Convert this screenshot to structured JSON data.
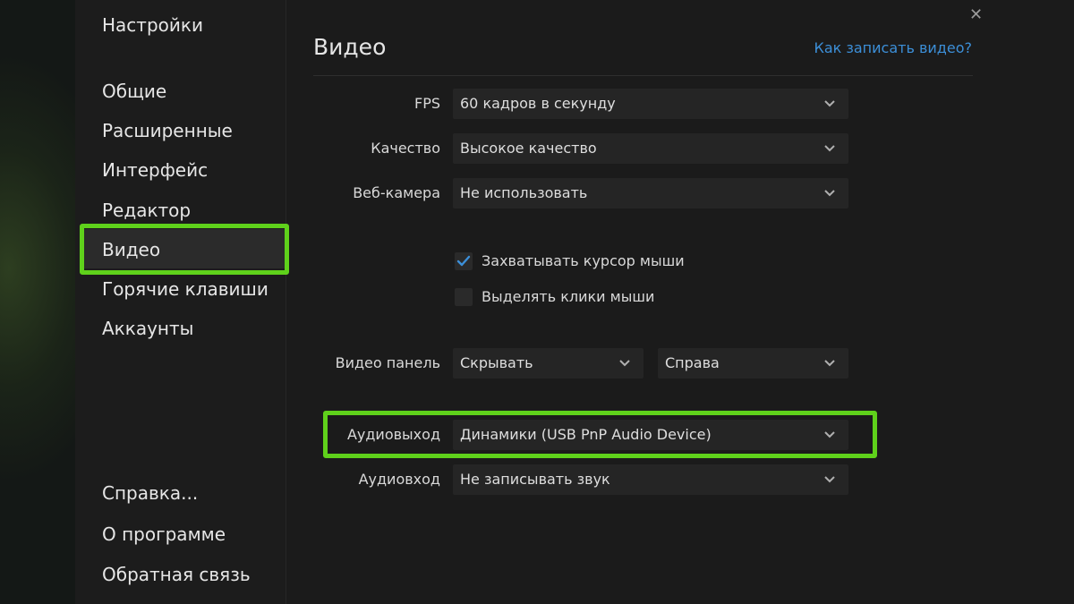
{
  "sidebar": {
    "heading": "Настройки",
    "items": [
      {
        "label": "Общие"
      },
      {
        "label": "Расширенные"
      },
      {
        "label": "Интерфейс"
      },
      {
        "label": "Редактор"
      },
      {
        "label": "Видео",
        "active": true
      },
      {
        "label": "Горячие клавиши"
      },
      {
        "label": "Аккаунты"
      }
    ],
    "bottom_items": [
      {
        "label": "Справка..."
      },
      {
        "label": "О программе"
      },
      {
        "label": "Обратная связь"
      }
    ]
  },
  "main": {
    "title": "Видео",
    "help_link": "Как записать видео?",
    "fps": {
      "label": "FPS",
      "value": "60 кадров в секунду"
    },
    "quality": {
      "label": "Качество",
      "value": "Высокое качество"
    },
    "webcam": {
      "label": "Веб-камера",
      "value": "Не использовать"
    },
    "capture_cursor": {
      "label": "Захватывать курсор мыши",
      "checked": true
    },
    "highlight_clicks": {
      "label": "Выделять клики мыши",
      "checked": false
    },
    "video_panel": {
      "label": "Видео панель",
      "value": "Скрывать",
      "position": "Справа"
    },
    "audio_out": {
      "label": "Аудиовыход",
      "value": "Динамики (USB PnP Audio Device)"
    },
    "audio_in": {
      "label": "Аудиовход",
      "value": "Не записывать звук"
    }
  },
  "colors": {
    "highlight": "#5fd11b",
    "link": "#3c8fd8",
    "check": "#3c8fd8"
  },
  "icons": [
    "close-icon",
    "chevron-down-icon",
    "checkmark-icon"
  ]
}
